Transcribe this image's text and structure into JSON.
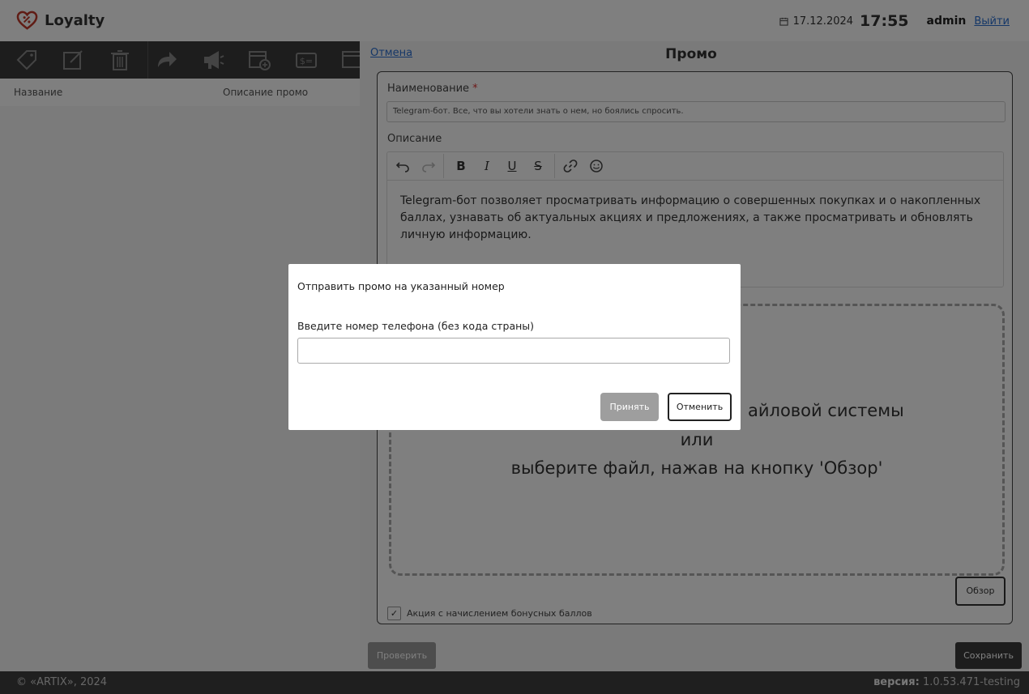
{
  "header": {
    "app_name": "Loyalty",
    "date": "17.12.2024",
    "time": "17:55",
    "user": "admin",
    "logout_label": "Выйти"
  },
  "toolbar": {
    "icons": [
      "tag-icon",
      "edit-icon",
      "trash-icon",
      "forward-icon",
      "megaphone-icon",
      "calendar-add-icon",
      "card-dollar-icon",
      "calendar-icon"
    ]
  },
  "list": {
    "columns": [
      "Название",
      "Описание промо"
    ]
  },
  "promo_panel": {
    "cancel_label": "Отмена",
    "title": "Промо",
    "name_label": "Наименование",
    "required_mark": "*",
    "name_value": "Telegram-бот. Все, что вы хотели знать о нем, но боялись спросить.",
    "description_label": "Описание",
    "description_text": "Telegram-бот позволяет просматривать информацию о совершенных покупках и о накопленных баллах, узнавать об актуальных акциях и предложениях, а также просматривать и обновлять личную информацию.",
    "editor_buttons": [
      "undo-icon",
      "redo-icon",
      "bold-icon",
      "italic-icon",
      "underline-icon",
      "strikethrough-icon",
      "link-icon",
      "emoji-icon"
    ],
    "dropzone_line1": "айловой системы",
    "dropzone_line2": "или",
    "dropzone_line3": "выберите файл, нажав на кнопку 'Обзор'",
    "browse_label": "Обзор",
    "bonus_checkbox_label": "Акция с начислением бонусных баллов",
    "bonus_checked": true,
    "check_label": "Проверить",
    "save_label": "Сохранить"
  },
  "footer": {
    "copyright": "© «ARTIX», 2024",
    "version_label": "версия:",
    "version_value": "1.0.53.471-testing"
  },
  "dialog": {
    "title": "Отправить промо на указанный номер",
    "phone_label": "Введите номер телефона (без кода страны)",
    "phone_value": "",
    "accept_label": "Принять",
    "cancel_label": "Отменить"
  },
  "colors": {
    "accent_red": "#c0392b",
    "link_blue": "#2a6fd0",
    "dark_bar": "#3a3a3a"
  }
}
